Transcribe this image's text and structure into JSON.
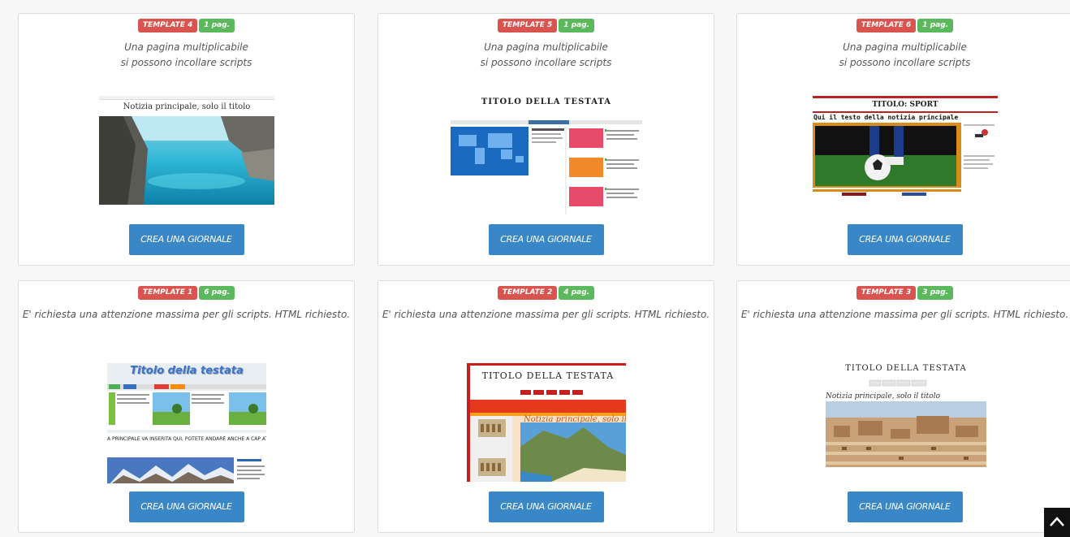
{
  "cards": [
    {
      "template_label": "TEMPLATE 4",
      "pages_label": "1 pag.",
      "description": "Una pagina multiplicabile\nsi possono incollare scripts",
      "button_label": "CREA UNA GIORNALE",
      "preview": {
        "headline": "Notizia principale, solo il titolo"
      }
    },
    {
      "template_label": "TEMPLATE 5",
      "pages_label": "1 pag.",
      "description": "Una pagina multiplicabile\nsi possono incollare scripts",
      "button_label": "CREA UNA GIORNALE",
      "preview": {
        "masthead": "TITOLO DELLA TESTATA"
      }
    },
    {
      "template_label": "TEMPLATE 6",
      "pages_label": "1 pag.",
      "description": "Una pagina multiplicabile\nsi possono incollare scripts",
      "button_label": "CREA UNA GIORNALE",
      "preview": {
        "masthead": "TITOLO: SPORT",
        "headline": "Qui il testo della notizia principale"
      }
    },
    {
      "template_label": "TEMPLATE 1",
      "pages_label": "6 pag.",
      "description": "E' richiesta una attenzione massima per gli scripts. HTML richiesto.",
      "button_label": "CREA UNA GIORNALE",
      "preview": {
        "masthead": "Titolo della testata",
        "body_text": "A PRINCIPALE VA INSERITA QUI, POTETE ANDARE ANCHE A CAP ATE VOI."
      }
    },
    {
      "template_label": "TEMPLATE 2",
      "pages_label": "4 pag.",
      "description": "E' richiesta una attenzione massima per gli scripts. HTML richiesto.",
      "button_label": "CREA UNA GIORNALE",
      "preview": {
        "masthead": "TITOLO DELLA TESTATA",
        "headline": "Notizia principale, solo il"
      }
    },
    {
      "template_label": "TEMPLATE 3",
      "pages_label": "3 pag.",
      "description": "E' richiesta una attenzione massima per gli scripts. HTML richiesto.",
      "button_label": "CREA UNA GIORNALE",
      "preview": {
        "masthead": "TITOLO DELLA TESTATA",
        "headline": "Notizia principale, solo il titolo"
      }
    }
  ],
  "colors": {
    "template_badge": "#d9534f",
    "pages_badge": "#5cb85c",
    "button": "#3a87c8"
  },
  "icons": {
    "scroll_top": "chevron-up-icon"
  }
}
